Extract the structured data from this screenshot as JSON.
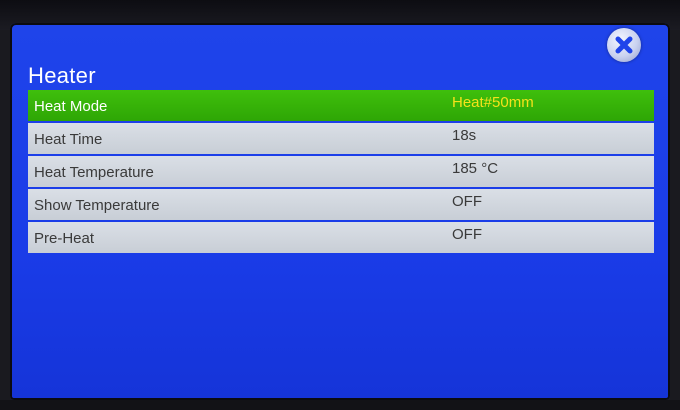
{
  "dialog": {
    "title": "Heater",
    "close_icon": "close-x-circle-icon"
  },
  "settings": [
    {
      "label": "Heat Mode",
      "value": "Heat#50mm",
      "selected": true
    },
    {
      "label": "Heat Time",
      "value": "18s",
      "selected": false
    },
    {
      "label": "Heat Temperature",
      "value": "185 °C",
      "selected": false
    },
    {
      "label": "Show Temperature",
      "value": "OFF",
      "selected": false
    },
    {
      "label": "Pre-Heat",
      "value": "OFF",
      "selected": false
    }
  ],
  "colors": {
    "screen_background": "#1a3ce8",
    "selected_row": "#36b208",
    "selected_value_text": "#f5e21b",
    "row_background": "#d2d7de"
  }
}
